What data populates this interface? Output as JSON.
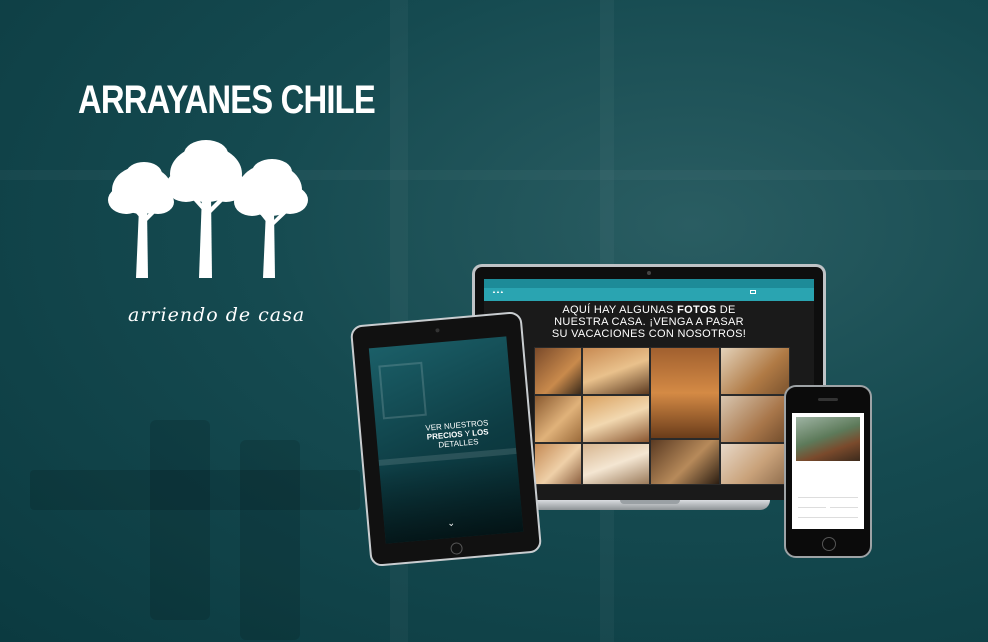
{
  "brand": {
    "title": "ARRAYANES CHILE",
    "tagline": "arriendo de casa",
    "icon": "three-trees-logo"
  },
  "colors": {
    "background": "#154a50",
    "accent": "#2aa4b1",
    "top_strip": "#1d8b98",
    "text": "#ffffff"
  },
  "laptop": {
    "headline_line1_pre": "AQUÍ HAY ALGUNAS ",
    "headline_line1_bold": "FOTOS",
    "headline_line1_post": " DE",
    "headline_line2": "NUESTRA CASA. ¡VENGA A PASAR",
    "headline_line3": "SU VACACIONES CON NOSOTROS!"
  },
  "tablet": {
    "headline_line1": "VER NUESTROS",
    "headline_line2_bold1": "PRECIOS",
    "headline_line2_mid": " Y ",
    "headline_line2_bold2": "LOS",
    "headline_line3": "DETALLES"
  }
}
